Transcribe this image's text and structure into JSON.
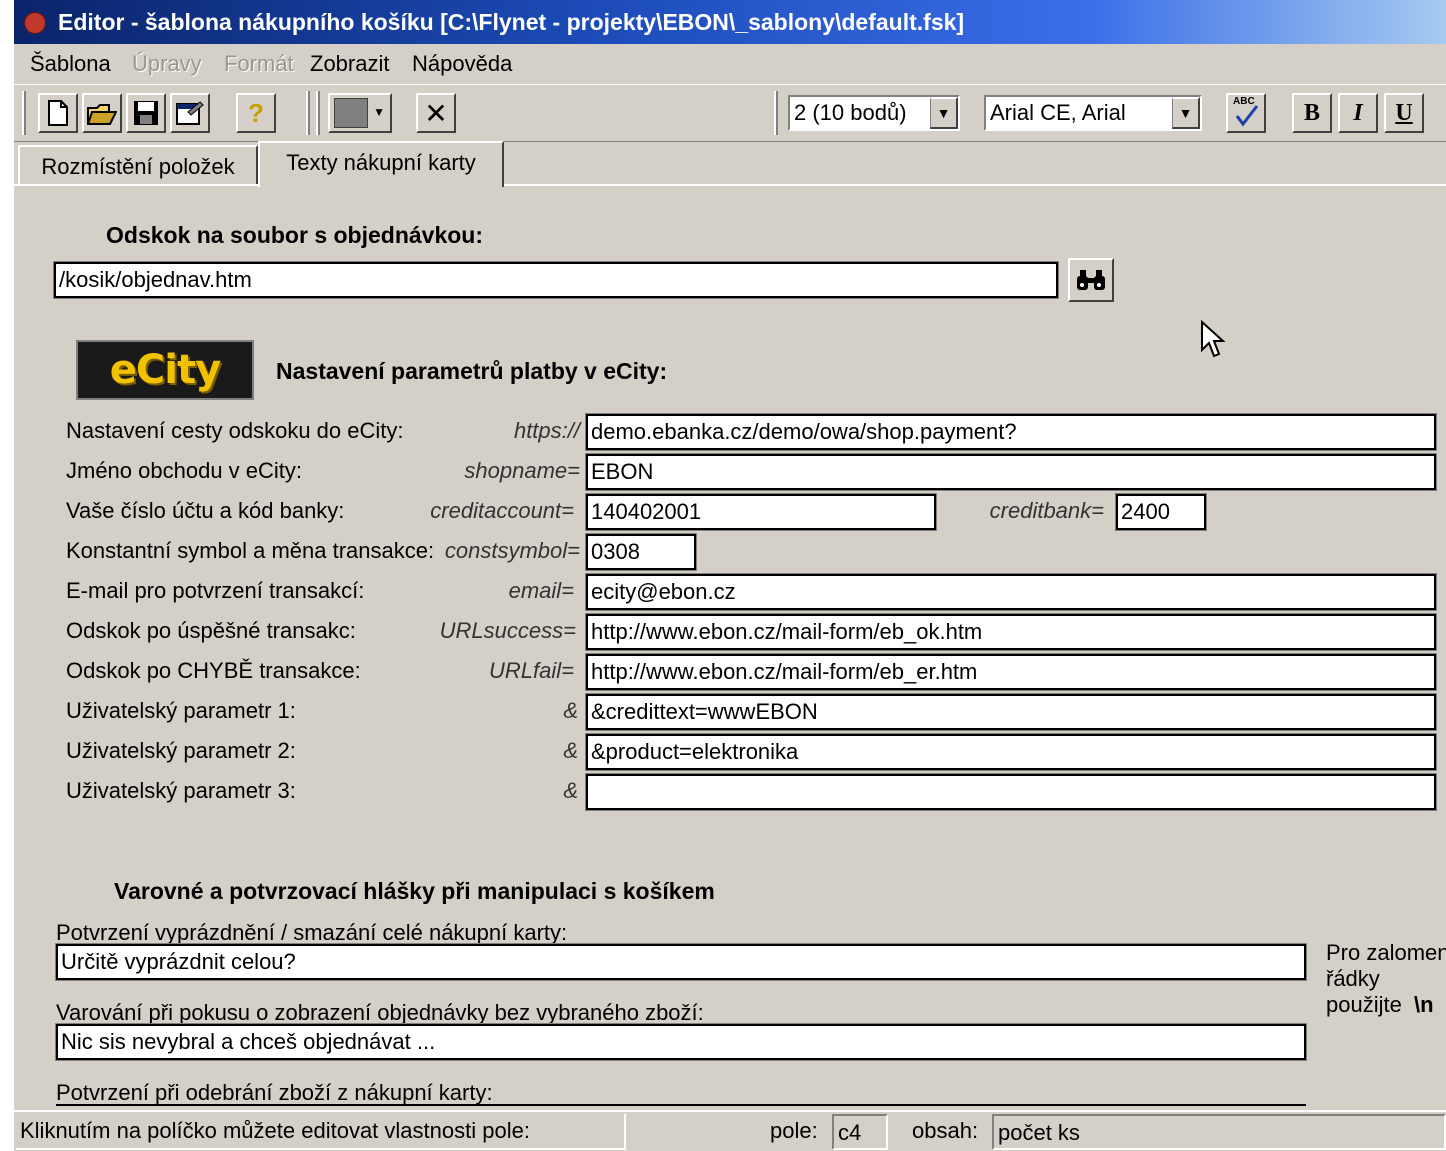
{
  "window": {
    "title": "Editor - šablona nákupního košíku [C:\\Flynet - projekty\\EBON\\_sablony\\default.fsk]"
  },
  "menu": {
    "items": [
      {
        "label": "Šablona",
        "disabled": false
      },
      {
        "label": "Úpravy",
        "disabled": true
      },
      {
        "label": "Formát",
        "disabled": true
      },
      {
        "label": "Zobrazit",
        "disabled": false
      },
      {
        "label": "Nápověda",
        "disabled": false
      }
    ]
  },
  "toolbar": {
    "icons": [
      "new-file-icon",
      "open-folder-icon",
      "save-icon",
      "properties-icon",
      "help-icon",
      "color-picker-icon",
      "delete-icon",
      "spellcheck-icon",
      "bold-icon",
      "italic-icon",
      "underline-icon"
    ],
    "help_glyph": "?",
    "delete_glyph": "✕",
    "spell_glyph": "ABC",
    "bold_label": "B",
    "italic_label": "I",
    "underline_label": "U",
    "font_size": "2 (10 bodů)",
    "font_family": "Arial CE, Arial"
  },
  "tabs": [
    {
      "label": "Rozmístění položek",
      "active": false
    },
    {
      "label": "Texty nákupní karty",
      "active": true
    }
  ],
  "order_link": {
    "heading": "Odskok na soubor s objednávkou:",
    "value": "/kosik/objednav.htm"
  },
  "ecity": {
    "logo_text": "eCity",
    "heading": "Nastavení parametrů platby v eCity:",
    "rows": [
      {
        "label": "Nastavení cesty odskoku do eCity:",
        "param": "https://",
        "value": "demo.ebanka.cz/demo/owa/shop.payment?"
      },
      {
        "label": "Jméno obchodu v eCity:",
        "param": "shopname=",
        "value": "EBON"
      },
      {
        "label": "Vaše číslo účtu a kód banky:",
        "param": "creditaccount=",
        "value": "140402001",
        "param2": "creditbank=",
        "value2": "2400"
      },
      {
        "label": "Konstantní symbol a měna transakce:",
        "param": "constsymbol=",
        "value": "0308"
      },
      {
        "label": "E-mail pro potvrzení transakcí:",
        "param": "email=",
        "value": "ecity@ebon.cz"
      },
      {
        "label": "Odskok po úspěšné transakc:",
        "param": "URLsuccess=",
        "value": "http://www.ebon.cz/mail-form/eb_ok.htm"
      },
      {
        "label": "Odskok po CHYBĚ transakce:",
        "param": "URLfail=",
        "value": "http://www.ebon.cz/mail-form/eb_er.htm"
      },
      {
        "label": "Uživatelský parametr 1:",
        "param": "&",
        "value": "&credittext=wwwEBON"
      },
      {
        "label": "Uživatelský parametr 2:",
        "param": "&",
        "value": "&product=elektronika"
      },
      {
        "label": "Uživatelský parametr 3:",
        "param": "&",
        "value": ""
      }
    ]
  },
  "messages": {
    "heading": "Varovné a potvrzovací hlášky při manipulaci s košíkem",
    "items": [
      {
        "label": "Potvrzení vyprázdnění / smazání celé nákupní karty:",
        "value": "Určitě vyprázdnit celou?"
      },
      {
        "label": "Varování při pokusu o zobrazení objednávky bez vybraného zboží:",
        "value": "Nic sis nevybral a chceš objednávat ..."
      },
      {
        "label": "Potvrzení při odebrání zboží z nákupní karty:",
        "value": ""
      }
    ],
    "hint_line1": "Pro zalomení",
    "hint_line2": "řádky",
    "hint_line3": "použijte",
    "hint_code": "\\n"
  },
  "status": {
    "hint": "Kliknutím na políčko můžete editovat vlastnosti pole:",
    "pole_label": "pole:",
    "pole_value": "c4",
    "obsah_label": "obsah:",
    "obsah_value": "počet ks"
  },
  "colors": {
    "face": "#d4d0c8",
    "title_start": "#0a246a",
    "title_end": "#a6caf0",
    "logo_bg": "#1a1a1a",
    "logo_fg": "#f2c200"
  }
}
